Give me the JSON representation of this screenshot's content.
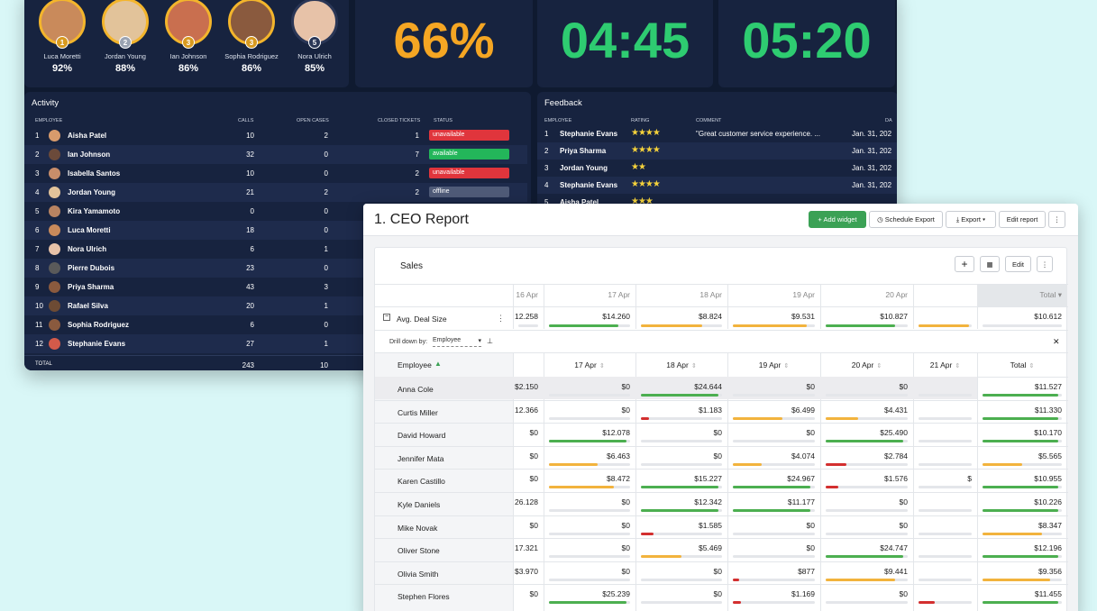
{
  "leaderboard": [
    {
      "name": "Luca Moretti",
      "pct": "92%",
      "rank": "1",
      "color": "#c98a5b"
    },
    {
      "name": "Jordan Young",
      "pct": "88%",
      "rank": "2",
      "color": "#e2c39a"
    },
    {
      "name": "Ian Johnson",
      "pct": "86%",
      "rank": "3",
      "color": "#c96f4f"
    },
    {
      "name": "Sophia Rodriguez",
      "pct": "86%",
      "rank": "3",
      "color": "#8a5a3e"
    },
    {
      "name": "Nora Ulrich",
      "pct": "85%",
      "rank": "5",
      "color": "#e7c2a8"
    }
  ],
  "kpis": {
    "percent": "66%",
    "time1": "04:45",
    "time2": "05:20"
  },
  "activity": {
    "title": "Activity",
    "headers": {
      "employee": "EMPLOYEE",
      "calls": "CALLS",
      "open": "OPEN CASES",
      "closed": "CLOSED TICKETS",
      "status": "STATUS"
    },
    "rows": [
      {
        "n": "1",
        "name": "Aisha Patel",
        "calls": "10",
        "open": "2",
        "closed": "1",
        "status": "unavailable"
      },
      {
        "n": "2",
        "name": "Ian Johnson",
        "calls": "32",
        "open": "0",
        "closed": "7",
        "status": "available"
      },
      {
        "n": "3",
        "name": "Isabella Santos",
        "calls": "10",
        "open": "0",
        "closed": "2",
        "status": "unavailable"
      },
      {
        "n": "4",
        "name": "Jordan Young",
        "calls": "21",
        "open": "2",
        "closed": "2",
        "status": "offline"
      },
      {
        "n": "5",
        "name": "Kira Yamamoto",
        "calls": "0",
        "open": "0",
        "closed": "",
        "status": ""
      },
      {
        "n": "6",
        "name": "Luca Moretti",
        "calls": "18",
        "open": "0",
        "closed": "",
        "status": ""
      },
      {
        "n": "7",
        "name": "Nora Ulrich",
        "calls": "6",
        "open": "1",
        "closed": "",
        "status": ""
      },
      {
        "n": "8",
        "name": "Pierre Dubois",
        "calls": "23",
        "open": "0",
        "closed": "",
        "status": ""
      },
      {
        "n": "9",
        "name": "Priya Sharma",
        "calls": "43",
        "open": "3",
        "closed": "",
        "status": ""
      },
      {
        "n": "10",
        "name": "Rafael Silva",
        "calls": "20",
        "open": "1",
        "closed": "",
        "status": ""
      },
      {
        "n": "11",
        "name": "Sophia Rodriguez",
        "calls": "6",
        "open": "0",
        "closed": "",
        "status": ""
      },
      {
        "n": "12",
        "name": "Stephanie Evans",
        "calls": "27",
        "open": "1",
        "closed": "",
        "status": ""
      }
    ],
    "total": {
      "label": "TOTAL",
      "calls": "243",
      "open": "10"
    },
    "status_colors": {
      "unavailable": "#e0353c",
      "available": "#23b65a",
      "offline": "#4f5b78"
    }
  },
  "feedback": {
    "title": "Feedback",
    "headers": {
      "employee": "EMPLOYEE",
      "rating": "RATING",
      "comment": "COMMENT",
      "date": "DA"
    },
    "rows": [
      {
        "n": "1",
        "name": "Stephanie Evans",
        "rating": "★★★★",
        "comment": "\"Great customer service experience. ...",
        "date": "Jan. 31, 202"
      },
      {
        "n": "2",
        "name": "Priya Sharma",
        "rating": "★★★★",
        "comment": "",
        "date": "Jan. 31, 202"
      },
      {
        "n": "3",
        "name": "Jordan Young",
        "rating": "★★",
        "comment": "",
        "date": "Jan. 31, 202"
      },
      {
        "n": "4",
        "name": "Stephanie Evans",
        "rating": "★★★★",
        "comment": "",
        "date": "Jan. 31, 202"
      },
      {
        "n": "5",
        "name": "Aisha Patel",
        "rating": "★★★",
        "comment": "",
        "date": ""
      }
    ]
  },
  "report": {
    "title": "1. CEO Report",
    "buttons": {
      "add": "+ Add widget",
      "schedule": "Schedule Export",
      "export": "Export ▾",
      "edit": "Edit report"
    },
    "widget": {
      "title": "Sales",
      "edit": "Edit",
      "plus": "+"
    },
    "dates": [
      "16 Apr",
      "17 Apr",
      "18 Apr",
      "19 Apr",
      "20 Apr",
      "",
      "Total ▾"
    ],
    "avg": {
      "label": "Avg. Deal Size",
      "values": [
        "12.258",
        "$14.260",
        "$8.824",
        "$9.531",
        "$10.827",
        "",
        "$10.612"
      ],
      "fills": [
        0.0,
        0.85,
        0.75,
        0.9,
        0.85,
        0.95,
        0.0
      ],
      "colors": [
        "#4caf50",
        "#4caf50",
        "#f2b33d",
        "#f2b33d",
        "#4caf50",
        "#f2b33d",
        "#4caf50"
      ]
    },
    "drill": {
      "label": "Drill down by:",
      "value": "Employee",
      "close": "✕"
    },
    "cols": [
      "Employee",
      "17 Apr",
      "18 Apr",
      "19 Apr",
      "20 Apr",
      "21 Apr",
      "Total"
    ],
    "rows": [
      {
        "name": "Anna Cole",
        "v": [
          "$2.150",
          "$0",
          "$24.644",
          "$0",
          "$0",
          "",
          "$11.527"
        ],
        "f": [
          0,
          0,
          0.95,
          0,
          0,
          0,
          0.95
        ],
        "c": [
          "#4caf50",
          "#4caf50",
          "#4caf50",
          "#4caf50",
          "#4caf50",
          "#4caf50",
          "#4caf50"
        ]
      },
      {
        "name": "Curtis Miller",
        "v": [
          "12.366",
          "$0",
          "$1.183",
          "$6.499",
          "$4.431",
          "",
          "$11.330"
        ],
        "f": [
          0.3,
          0,
          0.1,
          0.6,
          0.4,
          0,
          0.95
        ],
        "c": [
          "#4caf50",
          "#4caf50",
          "#d32f2f",
          "#f2b33d",
          "#f2b33d",
          "#4caf50",
          "#4caf50"
        ]
      },
      {
        "name": "David Howard",
        "v": [
          "$0",
          "$12.078",
          "$0",
          "$0",
          "$25.490",
          "",
          "$10.170"
        ],
        "f": [
          0,
          0.95,
          0,
          0,
          0.95,
          0,
          0.95
        ],
        "c": [
          "#4caf50",
          "#4caf50",
          "#4caf50",
          "#4caf50",
          "#4caf50",
          "#4caf50",
          "#4caf50"
        ]
      },
      {
        "name": "Jennifer Mata",
        "v": [
          "$0",
          "$6.463",
          "$0",
          "$4.074",
          "$2.784",
          "",
          "$5.565"
        ],
        "f": [
          0,
          0.6,
          0,
          0.35,
          0.25,
          0,
          0.5
        ],
        "c": [
          "#4caf50",
          "#f2b33d",
          "#4caf50",
          "#f2b33d",
          "#d32f2f",
          "#4caf50",
          "#f2b33d"
        ]
      },
      {
        "name": "Karen Castillo",
        "v": [
          "$0",
          "$8.472",
          "$15.227",
          "$24.967",
          "$1.576",
          "$",
          "$10.955"
        ],
        "f": [
          0,
          0.8,
          0.95,
          0.95,
          0.15,
          0,
          0.95
        ],
        "c": [
          "#4caf50",
          "#f2b33d",
          "#4caf50",
          "#4caf50",
          "#d32f2f",
          "#4caf50",
          "#4caf50"
        ]
      },
      {
        "name": "Kyle Daniels",
        "v": [
          "26.128",
          "$0",
          "$12.342",
          "$11.177",
          "$0",
          "",
          "$10.226"
        ],
        "f": [
          0.3,
          0,
          0.95,
          0.95,
          0,
          0,
          0.95
        ],
        "c": [
          "#4caf50",
          "#4caf50",
          "#4caf50",
          "#4caf50",
          "#4caf50",
          "#4caf50",
          "#4caf50"
        ]
      },
      {
        "name": "Mike Novak",
        "v": [
          "$0",
          "$0",
          "$1.585",
          "$0",
          "$0",
          "",
          "$8.347"
        ],
        "f": [
          0,
          0,
          0.15,
          0,
          0,
          0,
          0.75
        ],
        "c": [
          "#4caf50",
          "#4caf50",
          "#d32f2f",
          "#4caf50",
          "#4caf50",
          "#4caf50",
          "#f2b33d"
        ]
      },
      {
        "name": "Oliver Stone",
        "v": [
          "17.321",
          "$0",
          "$5.469",
          "$0",
          "$24.747",
          "",
          "$12.196"
        ],
        "f": [
          0.3,
          0,
          0.5,
          0,
          0.95,
          0,
          0.95
        ],
        "c": [
          "#4caf50",
          "#4caf50",
          "#f2b33d",
          "#4caf50",
          "#4caf50",
          "#4caf50",
          "#4caf50"
        ]
      },
      {
        "name": "Olivia Smith",
        "v": [
          "$3.970",
          "$0",
          "$0",
          "$877",
          "$9.441",
          "",
          "$9.356"
        ],
        "f": [
          0,
          0,
          0,
          0.08,
          0.85,
          0,
          0.85
        ],
        "c": [
          "#4caf50",
          "#4caf50",
          "#4caf50",
          "#d32f2f",
          "#f2b33d",
          "#4caf50",
          "#f2b33d"
        ]
      },
      {
        "name": "Stephen Flores",
        "v": [
          "$0",
          "$25.239",
          "$0",
          "$1.169",
          "$0",
          "",
          "$11.455"
        ],
        "f": [
          0,
          0.95,
          0,
          0.1,
          0,
          0.3,
          0.95
        ],
        "c": [
          "#4caf50",
          "#4caf50",
          "#4caf50",
          "#d32f2f",
          "#4caf50",
          "#d32f2f",
          "#4caf50"
        ]
      }
    ]
  }
}
